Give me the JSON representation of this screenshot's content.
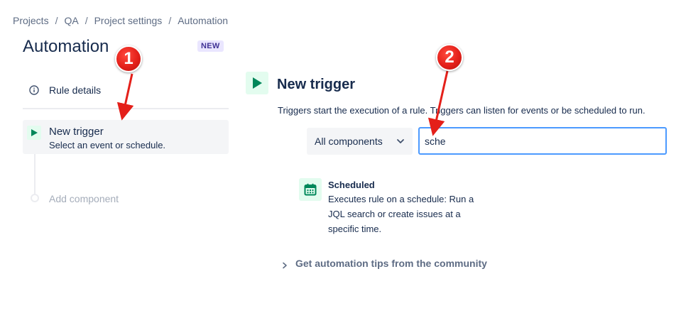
{
  "breadcrumb": {
    "items": [
      "Projects",
      "QA",
      "Project settings",
      "Automation"
    ],
    "separator": "/"
  },
  "page": {
    "title": "Automation",
    "badge": "NEW"
  },
  "sidebar": {
    "rule_details_label": "Rule details",
    "trigger_title": "New trigger",
    "trigger_subtitle": "Select an event or schedule.",
    "add_component_label": "Add component"
  },
  "main": {
    "header": "New trigger",
    "description": "Triggers start the execution of a rule. Triggers can listen for events or be scheduled to run.",
    "filter_select": "All components",
    "search": {
      "value": "sche",
      "placeholder": ""
    },
    "result": {
      "title": "Scheduled",
      "description": "Executes rule on a schedule: Run a JQL search or create issues at a specific time."
    },
    "tips_label": "Get automation tips from the community"
  },
  "annotations": {
    "marker_1": "1",
    "marker_2": "2"
  },
  "colors": {
    "accent_green": "#00875a",
    "green_bg": "#e3fcef",
    "focus_blue": "#4c9aff",
    "badge_bg": "#eae6ff",
    "badge_text": "#403294",
    "annotation_red": "#e4201a"
  },
  "icons": {
    "rule_details": "info-icon",
    "trigger": "play-icon",
    "select": "chevron-down-icon",
    "result": "calendar-icon",
    "tips": "chevron-right-icon"
  }
}
